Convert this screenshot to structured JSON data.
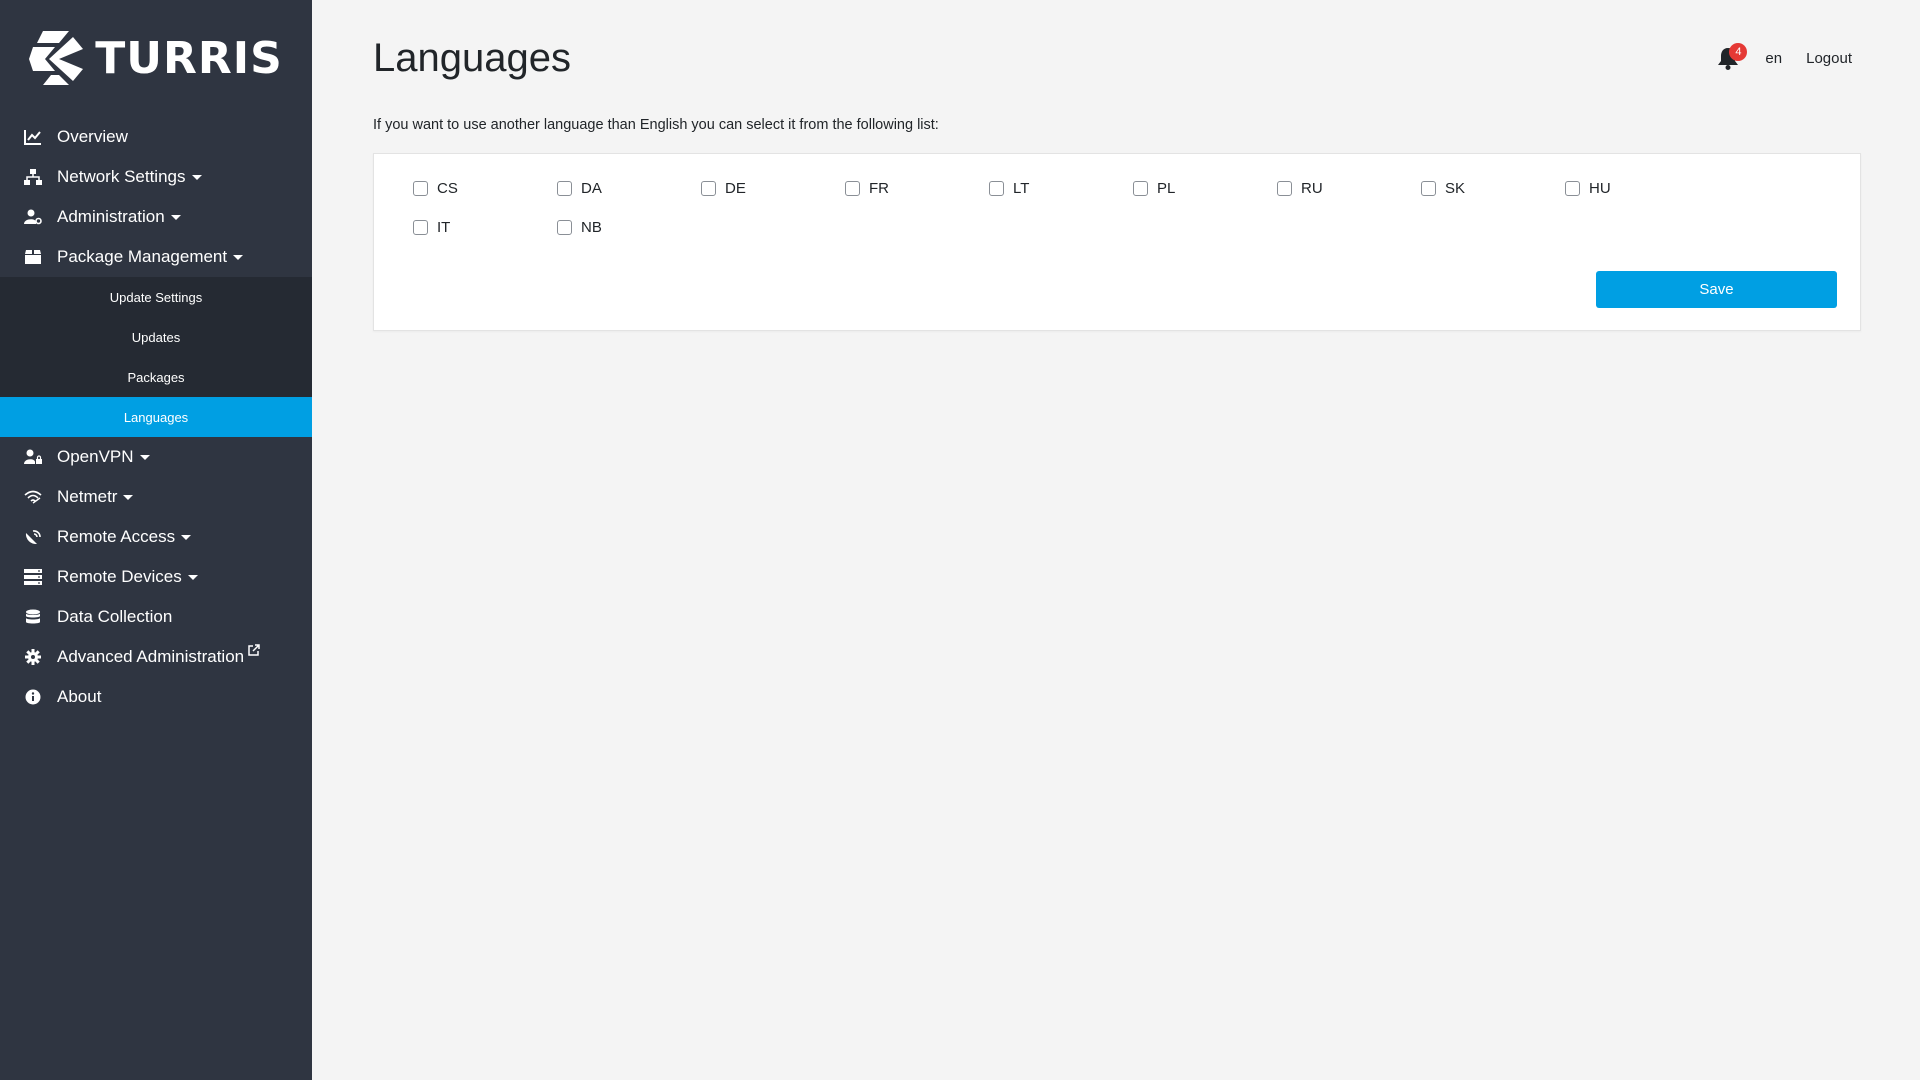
{
  "brand": {
    "name": "TURRIS"
  },
  "sidebar": {
    "items": [
      {
        "label": "Overview",
        "icon": "chart-line-icon"
      },
      {
        "label": "Network Settings",
        "icon": "network-icon"
      },
      {
        "label": "Administration",
        "icon": "user-cog-icon"
      },
      {
        "label": "Package Management",
        "icon": "box-icon"
      },
      {
        "label": "OpenVPN",
        "icon": "user-lock-icon"
      },
      {
        "label": "Netmetr",
        "icon": "wifi-icon"
      },
      {
        "label": "Remote Access",
        "icon": "satellite-dish-icon"
      },
      {
        "label": "Remote Devices",
        "icon": "server-icon"
      },
      {
        "label": "Data Collection",
        "icon": "database-icon"
      },
      {
        "label": "Advanced Administration",
        "icon": "cog-icon"
      },
      {
        "label": "About",
        "icon": "info-icon"
      }
    ],
    "package_sub": [
      {
        "label": "Update Settings"
      },
      {
        "label": "Updates"
      },
      {
        "label": "Packages"
      },
      {
        "label": "Languages"
      }
    ]
  },
  "header": {
    "title": "Languages",
    "notification_count": "4",
    "language": "en",
    "logout": "Logout"
  },
  "main": {
    "intro": "If you want to use another language than English you can select it from the following list:",
    "languages": [
      "CS",
      "DA",
      "DE",
      "FR",
      "LT",
      "PL",
      "RU",
      "SK",
      "HU",
      "IT",
      "NB"
    ],
    "save_label": "Save"
  },
  "colors": {
    "sidebar_bg": "#2f3541",
    "submenu_bg": "#252a33",
    "accent": "#009fe3",
    "badge": "#e53935"
  }
}
